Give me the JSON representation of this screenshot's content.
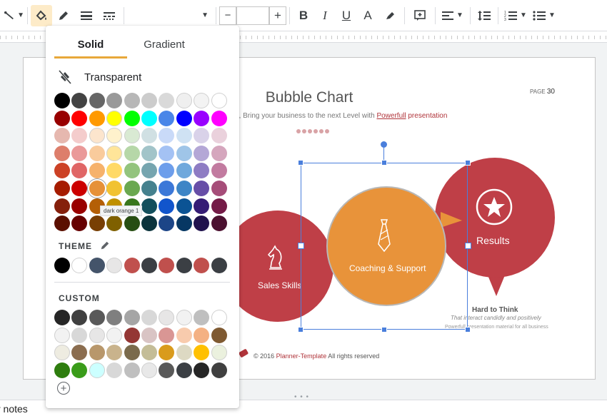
{
  "toolbar": {
    "tools": [
      {
        "name": "line-style-icon",
        "glyph": "╲"
      },
      {
        "name": "fill-color-icon",
        "glyph": "◆"
      },
      {
        "name": "border-color-icon",
        "glyph": "✎"
      },
      {
        "name": "border-weight-icon",
        "glyph": "☰"
      },
      {
        "name": "border-dash-icon",
        "glyph": "┅"
      }
    ],
    "font_size_minus": "−",
    "font_size_plus": "+",
    "bold": "B",
    "italic": "I",
    "underline": "U",
    "text_color": "A",
    "highlight": "✎",
    "insert_comment": "⊞",
    "align": "≡",
    "line_spacing": "↕",
    "numbered_list": "☷",
    "bulleted_list": "☷"
  },
  "slide": {
    "title": "Bubble Chart",
    "subtitle_a": "e, Bring your business to the next Level with ",
    "subtitle_b": "Powerfull",
    "subtitle_c": " presentation",
    "page_label": "PAGE",
    "page_number": "30",
    "bubbles": {
      "left_label": "Sales Skills",
      "center_label": "Coaching & Support",
      "right_label": "Results"
    },
    "hard_title": "Hard to Think",
    "hard_sub": "That interact candidly and positively",
    "hard_sub2": "Powerfull presentation material for all business",
    "footer_a": "© 2016 ",
    "footer_brand": "Planner-Template",
    "footer_b": " All rights reserved"
  },
  "notes_label": "r notes",
  "color_popup": {
    "tabs": [
      "Solid",
      "Gradient"
    ],
    "active_tab": "Solid",
    "transparent_label": "Transparent",
    "tooltip": "dark orange 1",
    "theme_label": "THEME",
    "custom_label": "CUSTOM",
    "add_custom": "+",
    "accent": "#e8a83a",
    "standard_rows": [
      [
        "#000000",
        "#434343",
        "#666666",
        "#999999",
        "#b7b7b7",
        "#cccccc",
        "#d9d9d9",
        "#efefef",
        "#f3f3f3",
        "#ffffff"
      ],
      [
        "#980000",
        "#ff0000",
        "#ff9900",
        "#ffff00",
        "#00ff00",
        "#00ffff",
        "#4a86e8",
        "#0000ff",
        "#9900ff",
        "#ff00ff"
      ],
      [
        "#e6b8af",
        "#f4cccc",
        "#fce5cd",
        "#fff2cc",
        "#d9ead3",
        "#d0e0e3",
        "#c9daf8",
        "#cfe2f3",
        "#d9d2e9",
        "#ead1dc"
      ],
      [
        "#dd7e6b",
        "#ea9999",
        "#f9cb9c",
        "#ffe599",
        "#b6d7a8",
        "#a2c4c9",
        "#a4c2f4",
        "#9fc5e8",
        "#b4a7d6",
        "#d5a6bd"
      ],
      [
        "#cc4125",
        "#e06666",
        "#f6b26b",
        "#ffd966",
        "#93c47d",
        "#76a5af",
        "#6d9eeb",
        "#6fa8dc",
        "#8e7cc3",
        "#c27ba0"
      ],
      [
        "#a61c00",
        "#cc0000",
        "#e69138",
        "#f1c232",
        "#6aa84f",
        "#45818e",
        "#3c78d8",
        "#3d85c6",
        "#674ea7",
        "#a64d79"
      ],
      [
        "#85200c",
        "#990000",
        "#b45f06",
        "#bf9000",
        "#38761d",
        "#134f5c",
        "#1155cc",
        "#0b5394",
        "#351c75",
        "#741b47"
      ],
      [
        "#5b0f00",
        "#660000",
        "#783f04",
        "#7f6000",
        "#274e13",
        "#0c343d",
        "#1c4587",
        "#073763",
        "#20124d",
        "#4c1130"
      ]
    ],
    "theme_row": [
      "#000000",
      "#ffffff",
      "#44546a",
      "#e7e6e6",
      "#c0504d",
      "#3b3f44",
      "#c0504d",
      "#3b3f44",
      "#c0504d",
      "#3b3f44"
    ],
    "custom_rows": [
      [
        "#262626",
        "#404040",
        "#595959",
        "#7f7f7f",
        "#a5a5a5",
        "#d8d8d8",
        "#e7e6e6",
        "#f2f2f2",
        "#bfbfbf",
        "#ffffff"
      ],
      [
        "#f2f2f2",
        "#d8d8d8",
        "#e7e6e6",
        "#f2f2f2",
        "#943634",
        "#d9c4c4",
        "#d99694",
        "#f8cbad",
        "#f4b183",
        "#7f5a32"
      ],
      [
        "#eeece1",
        "#8b6d4f",
        "#b8976b",
        "#c9b38c",
        "#7a6a4c",
        "#c4bd97",
        "#d99b1c",
        "#ddd9c3",
        "#ffc000",
        "#ebf1de"
      ],
      [
        "#2e7d0e",
        "#3a9c1a",
        "#ccffff",
        "#d8d8d8",
        "#bfbfbf",
        "#e8e8e8",
        "#595959",
        "#3b3f44",
        "#262626",
        "#404040"
      ]
    ]
  }
}
